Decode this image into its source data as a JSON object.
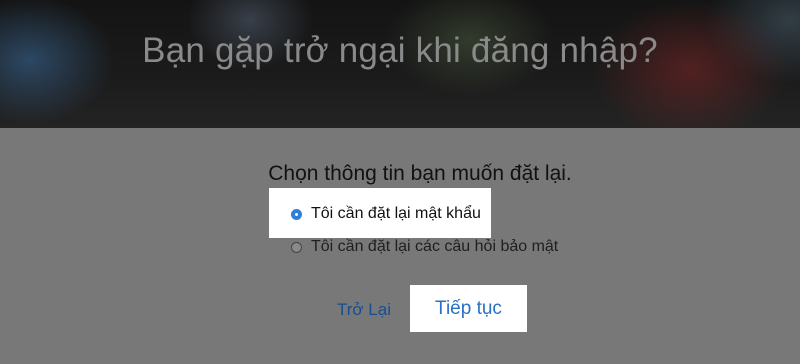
{
  "header": {
    "title": "Bạn gặp trở ngại khi đăng nhập?"
  },
  "form": {
    "prompt": "Chọn thông tin bạn muốn đặt lại.",
    "options": [
      {
        "label": "Tôi cần đặt lại mật khẩu",
        "selected": true
      },
      {
        "label": "Tôi cần đặt lại các câu hỏi bảo mật",
        "selected": false
      }
    ],
    "back_label": "Trở Lại",
    "continue_label": "Tiếp tục"
  },
  "colors": {
    "accent": "#2f7fe0",
    "link": "#1a4d8f",
    "overlay": "#787878"
  }
}
